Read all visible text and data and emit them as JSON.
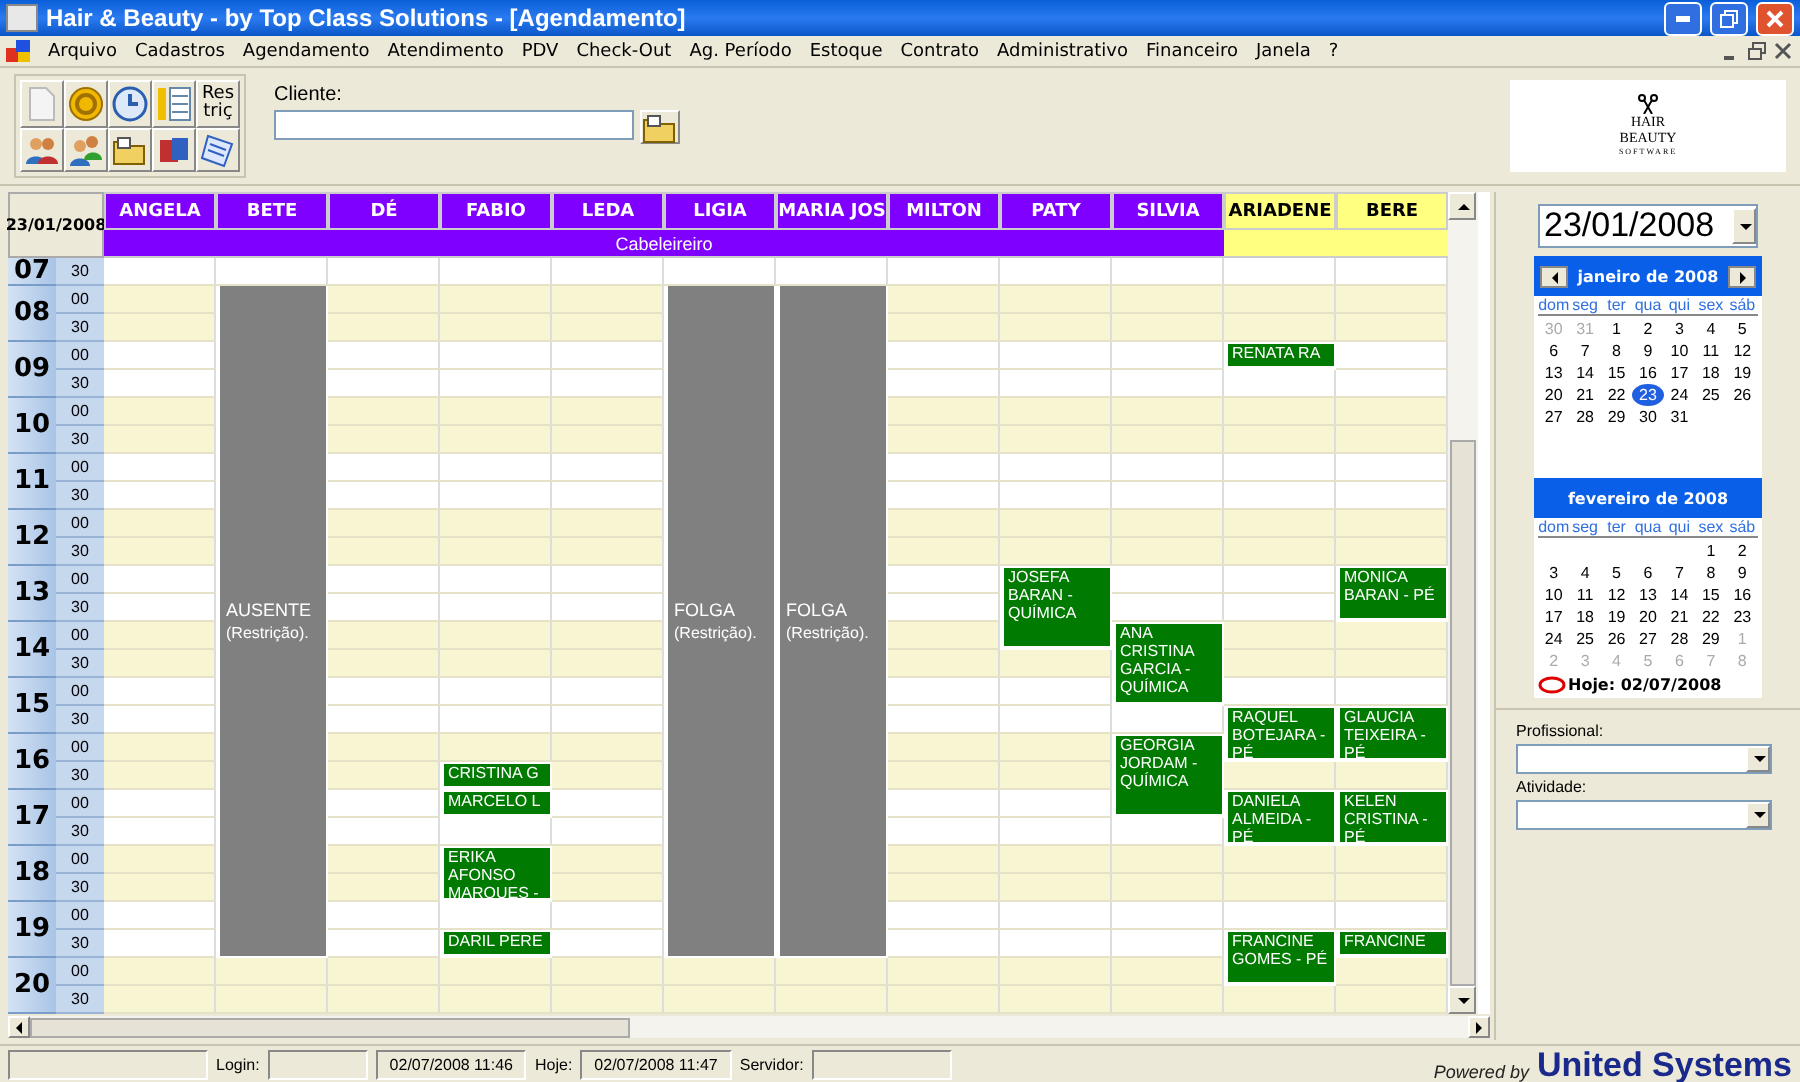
{
  "window": {
    "title": "Hair & Beauty - by Top Class Solutions - [Agendamento]"
  },
  "menu": [
    "Arquivo",
    "Cadastros",
    "Agendamento",
    "Atendimento",
    "PDV",
    "Check-Out",
    "Ag. Período",
    "Estoque",
    "Contrato",
    "Administrativo",
    "Financeiro",
    "Janela",
    "?"
  ],
  "toolbar": [
    {
      "kind": "icon"
    },
    {
      "kind": "icon"
    },
    {
      "kind": "icon"
    },
    {
      "kind": "icon"
    },
    {
      "kind": "text",
      "label": "Res triç"
    },
    {
      "kind": "icon"
    },
    {
      "kind": "icon"
    },
    {
      "kind": "icon"
    },
    {
      "kind": "icon"
    },
    {
      "kind": "icon"
    }
  ],
  "client": {
    "label": "Cliente:"
  },
  "logo": {
    "line_1": "HAIR",
    "line_2": "BEAUTY",
    "line_3": "SOFTWARE"
  },
  "schedule": {
    "date": "23/01/2008",
    "groups": [
      {
        "label": "Cabeleireiro",
        "color": "#8000ff",
        "columns": [
          "ANGELA",
          "BETE",
          "DÉ",
          "FABIO",
          "LEDA",
          "LIGIA",
          "MARIA JOS",
          "MILTON",
          "PATY",
          "SILVIA"
        ]
      },
      {
        "color": "#ffff80",
        "columns": [
          "ARIADENE",
          "BERE"
        ]
      }
    ],
    "hours": [
      {
        "hour": "07",
        "rows": [
          {
            "minute": "30",
            "cells": [
              {
                "kind": "free"
              },
              {
                "kind": "free"
              },
              {
                "kind": "free"
              },
              {
                "kind": "free"
              },
              {
                "kind": "free"
              },
              {
                "kind": "free"
              },
              {
                "kind": "free"
              },
              {
                "kind": "free"
              },
              {
                "kind": "free"
              },
              {
                "kind": "free"
              },
              {
                "kind": "free"
              },
              {
                "kind": "free"
              }
            ]
          }
        ]
      },
      {
        "hour": "08",
        "rows": [
          {
            "minute": "00",
            "cells": [
              {
                "kind": "free"
              },
              {
                "kind": "restriction",
                "text": "AUSENTE",
                "note": "(Restrição)."
              },
              {
                "kind": "free"
              },
              {
                "kind": "free"
              },
              {
                "kind": "free"
              },
              {
                "kind": "restriction",
                "text": "FOLGA",
                "note": "(Restrição)."
              },
              {
                "kind": "restriction",
                "text": "FOLGA",
                "note": "(Restrição)."
              },
              {
                "kind": "free"
              },
              {
                "kind": "free"
              },
              {
                "kind": "free"
              },
              {
                "kind": "free"
              },
              {
                "kind": "free"
              }
            ]
          },
          {
            "minute": "30",
            "cells": [
              {
                "kind": "free"
              },
              {
                "kind": "cont"
              },
              {
                "kind": "free"
              },
              {
                "kind": "free"
              },
              {
                "kind": "free"
              },
              {
                "kind": "cont"
              },
              {
                "kind": "cont"
              },
              {
                "kind": "free"
              },
              {
                "kind": "free"
              },
              {
                "kind": "free"
              },
              {
                "kind": "free"
              },
              {
                "kind": "free"
              }
            ]
          }
        ]
      },
      {
        "hour": "09",
        "rows": [
          {
            "minute": "00",
            "cells": [
              {
                "kind": "free"
              },
              {
                "kind": "cont"
              },
              {
                "kind": "free"
              },
              {
                "kind": "free"
              },
              {
                "kind": "free"
              },
              {
                "kind": "cont"
              },
              {
                "kind": "cont"
              },
              {
                "kind": "free"
              },
              {
                "kind": "free"
              },
              {
                "kind": "free"
              },
              {
                "kind": "booking",
                "text": "RENATA RA"
              },
              {
                "kind": "free"
              }
            ]
          },
          {
            "minute": "30",
            "cells": [
              {
                "kind": "free"
              },
              {
                "kind": "cont"
              },
              {
                "kind": "free"
              },
              {
                "kind": "free"
              },
              {
                "kind": "free"
              },
              {
                "kind": "cont"
              },
              {
                "kind": "cont"
              },
              {
                "kind": "free"
              },
              {
                "kind": "free"
              },
              {
                "kind": "free"
              },
              {
                "kind": "free"
              },
              {
                "kind": "free"
              }
            ]
          }
        ]
      },
      {
        "hour": "10",
        "rows": [
          {
            "minute": "00",
            "cells": [
              {
                "kind": "free"
              },
              {
                "kind": "cont"
              },
              {
                "kind": "free"
              },
              {
                "kind": "free"
              },
              {
                "kind": "free"
              },
              {
                "kind": "cont"
              },
              {
                "kind": "cont"
              },
              {
                "kind": "free"
              },
              {
                "kind": "free"
              },
              {
                "kind": "free"
              },
              {
                "kind": "free"
              },
              {
                "kind": "free"
              }
            ]
          },
          {
            "minute": "30",
            "cells": [
              {
                "kind": "free"
              },
              {
                "kind": "cont"
              },
              {
                "kind": "free"
              },
              {
                "kind": "free"
              },
              {
                "kind": "free"
              },
              {
                "kind": "cont"
              },
              {
                "kind": "cont"
              },
              {
                "kind": "free"
              },
              {
                "kind": "free"
              },
              {
                "kind": "free"
              },
              {
                "kind": "free"
              },
              {
                "kind": "free"
              }
            ]
          }
        ]
      },
      {
        "hour": "11",
        "rows": [
          {
            "minute": "00",
            "cells": [
              {
                "kind": "free"
              },
              {
                "kind": "cont"
              },
              {
                "kind": "free"
              },
              {
                "kind": "free"
              },
              {
                "kind": "free"
              },
              {
                "kind": "cont"
              },
              {
                "kind": "cont"
              },
              {
                "kind": "free"
              },
              {
                "kind": "free"
              },
              {
                "kind": "free"
              },
              {
                "kind": "free"
              },
              {
                "kind": "free"
              }
            ]
          },
          {
            "minute": "30",
            "cells": [
              {
                "kind": "free"
              },
              {
                "kind": "cont"
              },
              {
                "kind": "free"
              },
              {
                "kind": "free"
              },
              {
                "kind": "free"
              },
              {
                "kind": "cont"
              },
              {
                "kind": "cont"
              },
              {
                "kind": "free"
              },
              {
                "kind": "free"
              },
              {
                "kind": "free"
              },
              {
                "kind": "free"
              },
              {
                "kind": "free"
              }
            ]
          }
        ]
      },
      {
        "hour": "12",
        "rows": [
          {
            "minute": "00",
            "cells": [
              {
                "kind": "free"
              },
              {
                "kind": "cont"
              },
              {
                "kind": "free"
              },
              {
                "kind": "free"
              },
              {
                "kind": "free"
              },
              {
                "kind": "cont"
              },
              {
                "kind": "cont"
              },
              {
                "kind": "free"
              },
              {
                "kind": "free"
              },
              {
                "kind": "free"
              },
              {
                "kind": "free"
              },
              {
                "kind": "free"
              }
            ]
          },
          {
            "minute": "30",
            "cells": [
              {
                "kind": "free"
              },
              {
                "kind": "cont"
              },
              {
                "kind": "free"
              },
              {
                "kind": "free"
              },
              {
                "kind": "free"
              },
              {
                "kind": "cont"
              },
              {
                "kind": "cont"
              },
              {
                "kind": "free"
              },
              {
                "kind": "free"
              },
              {
                "kind": "free"
              },
              {
                "kind": "free"
              },
              {
                "kind": "free"
              }
            ]
          }
        ]
      },
      {
        "hour": "13",
        "rows": [
          {
            "minute": "00",
            "cells": [
              {
                "kind": "free"
              },
              {
                "kind": "cont"
              },
              {
                "kind": "free"
              },
              {
                "kind": "free"
              },
              {
                "kind": "free"
              },
              {
                "kind": "cont"
              },
              {
                "kind": "cont"
              },
              {
                "kind": "free"
              },
              {
                "kind": "booking",
                "text": "JOSEFA BARAN - QUÍMICA"
              },
              {
                "kind": "free"
              },
              {
                "kind": "free"
              },
              {
                "kind": "booking",
                "text": "MONICA BARAN - PÉ"
              }
            ]
          },
          {
            "minute": "30",
            "cells": [
              {
                "kind": "free"
              },
              {
                "kind": "cont"
              },
              {
                "kind": "free"
              },
              {
                "kind": "free"
              },
              {
                "kind": "free"
              },
              {
                "kind": "cont"
              },
              {
                "kind": "cont"
              },
              {
                "kind": "free"
              },
              {
                "kind": "cont"
              },
              {
                "kind": "free"
              },
              {
                "kind": "free"
              },
              {
                "kind": "cont"
              }
            ]
          }
        ]
      },
      {
        "hour": "14",
        "rows": [
          {
            "minute": "00",
            "cells": [
              {
                "kind": "free"
              },
              {
                "kind": "cont"
              },
              {
                "kind": "free"
              },
              {
                "kind": "free"
              },
              {
                "kind": "free"
              },
              {
                "kind": "cont"
              },
              {
                "kind": "cont"
              },
              {
                "kind": "free"
              },
              {
                "kind": "cont"
              },
              {
                "kind": "booking",
                "text": "ANA CRISTINA GARCIA - QUÍMICA"
              },
              {
                "kind": "free"
              },
              {
                "kind": "free"
              }
            ]
          },
          {
            "minute": "30",
            "cells": [
              {
                "kind": "free"
              },
              {
                "kind": "cont"
              },
              {
                "kind": "free"
              },
              {
                "kind": "free"
              },
              {
                "kind": "free"
              },
              {
                "kind": "cont"
              },
              {
                "kind": "cont"
              },
              {
                "kind": "free"
              },
              {
                "kind": "free"
              },
              {
                "kind": "cont"
              },
              {
                "kind": "free"
              },
              {
                "kind": "free"
              }
            ]
          }
        ]
      },
      {
        "hour": "15",
        "rows": [
          {
            "minute": "00",
            "cells": [
              {
                "kind": "free"
              },
              {
                "kind": "cont"
              },
              {
                "kind": "free"
              },
              {
                "kind": "free"
              },
              {
                "kind": "free"
              },
              {
                "kind": "cont"
              },
              {
                "kind": "cont"
              },
              {
                "kind": "free"
              },
              {
                "kind": "free"
              },
              {
                "kind": "cont"
              },
              {
                "kind": "free"
              },
              {
                "kind": "free"
              }
            ]
          },
          {
            "minute": "30",
            "cells": [
              {
                "kind": "free"
              },
              {
                "kind": "cont"
              },
              {
                "kind": "free"
              },
              {
                "kind": "free"
              },
              {
                "kind": "free"
              },
              {
                "kind": "cont"
              },
              {
                "kind": "cont"
              },
              {
                "kind": "free"
              },
              {
                "kind": "free"
              },
              {
                "kind": "free"
              },
              {
                "kind": "booking",
                "text": "RAQUEL BOTEJARA - PÉ"
              },
              {
                "kind": "booking",
                "text": "GLAUCIA TEIXEIRA - PÉ"
              }
            ]
          }
        ]
      },
      {
        "hour": "16",
        "rows": [
          {
            "minute": "00",
            "cells": [
              {
                "kind": "free"
              },
              {
                "kind": "cont"
              },
              {
                "kind": "free"
              },
              {
                "kind": "free"
              },
              {
                "kind": "free"
              },
              {
                "kind": "cont"
              },
              {
                "kind": "cont"
              },
              {
                "kind": "free"
              },
              {
                "kind": "free"
              },
              {
                "kind": "booking",
                "text": "GEORGIA JORDAM - QUÍMICA"
              },
              {
                "kind": "cont"
              },
              {
                "kind": "cont"
              }
            ]
          },
          {
            "minute": "30",
            "cells": [
              {
                "kind": "free"
              },
              {
                "kind": "cont"
              },
              {
                "kind": "free"
              },
              {
                "kind": "booking",
                "text": "CRISTINA G"
              },
              {
                "kind": "free"
              },
              {
                "kind": "cont"
              },
              {
                "kind": "cont"
              },
              {
                "kind": "free"
              },
              {
                "kind": "free"
              },
              {
                "kind": "cont"
              },
              {
                "kind": "free"
              },
              {
                "kind": "free"
              }
            ]
          }
        ]
      },
      {
        "hour": "17",
        "rows": [
          {
            "minute": "00",
            "cells": [
              {
                "kind": "free"
              },
              {
                "kind": "cont"
              },
              {
                "kind": "free"
              },
              {
                "kind": "booking",
                "text": "MARCELO L"
              },
              {
                "kind": "free"
              },
              {
                "kind": "cont"
              },
              {
                "kind": "cont"
              },
              {
                "kind": "free"
              },
              {
                "kind": "free"
              },
              {
                "kind": "cont"
              },
              {
                "kind": "booking",
                "text": "DANIELA ALMEIDA - PÉ"
              },
              {
                "kind": "booking",
                "text": "KELEN CRISTINA - PÉ"
              }
            ]
          },
          {
            "minute": "30",
            "cells": [
              {
                "kind": "free"
              },
              {
                "kind": "cont"
              },
              {
                "kind": "free"
              },
              {
                "kind": "free"
              },
              {
                "kind": "free"
              },
              {
                "kind": "cont"
              },
              {
                "kind": "cont"
              },
              {
                "kind": "free"
              },
              {
                "kind": "free"
              },
              {
                "kind": "free"
              },
              {
                "kind": "cont"
              },
              {
                "kind": "cont"
              }
            ]
          }
        ]
      },
      {
        "hour": "18",
        "rows": [
          {
            "minute": "00",
            "cells": [
              {
                "kind": "free"
              },
              {
                "kind": "cont"
              },
              {
                "kind": "free"
              },
              {
                "kind": "booking",
                "text": "ERIKA AFONSO MARQUES -"
              },
              {
                "kind": "free"
              },
              {
                "kind": "cont"
              },
              {
                "kind": "cont"
              },
              {
                "kind": "free"
              },
              {
                "kind": "free"
              },
              {
                "kind": "free"
              },
              {
                "kind": "free"
              },
              {
                "kind": "free"
              }
            ]
          },
          {
            "minute": "30",
            "cells": [
              {
                "kind": "free"
              },
              {
                "kind": "cont"
              },
              {
                "kind": "free"
              },
              {
                "kind": "cont"
              },
              {
                "kind": "free"
              },
              {
                "kind": "cont"
              },
              {
                "kind": "cont"
              },
              {
                "kind": "free"
              },
              {
                "kind": "free"
              },
              {
                "kind": "free"
              },
              {
                "kind": "free"
              },
              {
                "kind": "free"
              }
            ]
          }
        ]
      },
      {
        "hour": "19",
        "rows": [
          {
            "minute": "00",
            "cells": [
              {
                "kind": "free"
              },
              {
                "kind": "cont"
              },
              {
                "kind": "free"
              },
              {
                "kind": "free"
              },
              {
                "kind": "free"
              },
              {
                "kind": "cont"
              },
              {
                "kind": "cont"
              },
              {
                "kind": "free"
              },
              {
                "kind": "free"
              },
              {
                "kind": "free"
              },
              {
                "kind": "free"
              },
              {
                "kind": "free"
              }
            ]
          },
          {
            "minute": "30",
            "cells": [
              {
                "kind": "free"
              },
              {
                "kind": "cont"
              },
              {
                "kind": "free"
              },
              {
                "kind": "booking",
                "text": "DARIL PERE"
              },
              {
                "kind": "free"
              },
              {
                "kind": "cont"
              },
              {
                "kind": "cont"
              },
              {
                "kind": "free"
              },
              {
                "kind": "free"
              },
              {
                "kind": "free"
              },
              {
                "kind": "booking",
                "text": "FRANCINE GOMES - PÉ"
              },
              {
                "kind": "booking",
                "text": "FRANCINE"
              }
            ]
          }
        ]
      },
      {
        "hour": "20",
        "rows": [
          {
            "minute": "00",
            "cells": [
              {
                "kind": "free"
              },
              {
                "kind": "free"
              },
              {
                "kind": "free"
              },
              {
                "kind": "free"
              },
              {
                "kind": "free"
              },
              {
                "kind": "free"
              },
              {
                "kind": "free"
              },
              {
                "kind": "free"
              },
              {
                "kind": "free"
              },
              {
                "kind": "free"
              },
              {
                "kind": "cont"
              },
              {
                "kind": "free"
              }
            ]
          },
          {
            "minute": "30",
            "cells": [
              {
                "kind": "free"
              },
              {
                "kind": "free"
              },
              {
                "kind": "free"
              },
              {
                "kind": "free"
              },
              {
                "kind": "free"
              },
              {
                "kind": "free"
              },
              {
                "kind": "free"
              },
              {
                "kind": "free"
              },
              {
                "kind": "free"
              },
              {
                "kind": "free"
              },
              {
                "kind": "free"
              },
              {
                "kind": "free"
              }
            ]
          }
        ]
      }
    ]
  },
  "date_picker": {
    "value": "23/01/2008"
  },
  "calendar": {
    "months": [
      {
        "title": "janeiro de 2008",
        "navigation": true,
        "weekdays": [
          "dom",
          "seg",
          "ter",
          "qua",
          "qui",
          "sex",
          "sáb"
        ],
        "weeks": [
          [
            {
              "day": "30",
              "outside": true,
              "selected": false
            },
            {
              "day": "31",
              "outside": true,
              "selected": false
            },
            {
              "day": "1",
              "outside": false,
              "selected": false
            },
            {
              "day": "2",
              "outside": false,
              "selected": false
            },
            {
              "day": "3",
              "outside": false,
              "selected": false
            },
            {
              "day": "4",
              "outside": false,
              "selected": false
            },
            {
              "day": "5",
              "outside": false,
              "selected": false
            }
          ],
          [
            {
              "day": "6",
              "outside": false,
              "selected": false
            },
            {
              "day": "7",
              "outside": false,
              "selected": false
            },
            {
              "day": "8",
              "outside": false,
              "selected": false
            },
            {
              "day": "9",
              "outside": false,
              "selected": false
            },
            {
              "day": "10",
              "outside": false,
              "selected": false
            },
            {
              "day": "11",
              "outside": false,
              "selected": false
            },
            {
              "day": "12",
              "outside": false,
              "selected": false
            }
          ],
          [
            {
              "day": "13",
              "outside": false,
              "selected": false
            },
            {
              "day": "14",
              "outside": false,
              "selected": false
            },
            {
              "day": "15",
              "outside": false,
              "selected": false
            },
            {
              "day": "16",
              "outside": false,
              "selected": false
            },
            {
              "day": "17",
              "outside": false,
              "selected": false
            },
            {
              "day": "18",
              "outside": false,
              "selected": false
            },
            {
              "day": "19",
              "outside": false,
              "selected": false
            }
          ],
          [
            {
              "day": "20",
              "outside": false,
              "selected": false
            },
            {
              "day": "21",
              "outside": false,
              "selected": false
            },
            {
              "day": "22",
              "outside": false,
              "selected": false
            },
            {
              "day": "23",
              "outside": false,
              "selected": true
            },
            {
              "day": "24",
              "outside": false,
              "selected": false
            },
            {
              "day": "25",
              "outside": false,
              "selected": false
            },
            {
              "day": "26",
              "outside": false,
              "selected": false
            }
          ],
          [
            {
              "day": "27",
              "outside": false,
              "selected": false
            },
            {
              "day": "28",
              "outside": false,
              "selected": false
            },
            {
              "day": "29",
              "outside": false,
              "selected": false
            },
            {
              "day": "30",
              "outside": false,
              "selected": false
            },
            {
              "day": "31",
              "outside": false,
              "selected": false
            }
          ]
        ]
      },
      {
        "title": "fevereiro de 2008",
        "navigation": false,
        "weekdays": [
          "dom",
          "seg",
          "ter",
          "qua",
          "qui",
          "sex",
          "sáb"
        ],
        "weeks": [
          [
            {
              "day": "1",
              "outside": false,
              "selected": false
            },
            {
              "day": "2",
              "outside": false,
              "selected": false
            }
          ],
          [
            {
              "day": "3",
              "outside": false,
              "selected": false
            },
            {
              "day": "4",
              "outside": false,
              "selected": false
            },
            {
              "day": "5",
              "outside": false,
              "selected": false
            },
            {
              "day": "6",
              "outside": false,
              "selected": false
            },
            {
              "day": "7",
              "outside": false,
              "selected": false
            },
            {
              "day": "8",
              "outside": false,
              "selected": false
            },
            {
              "day": "9",
              "outside": false,
              "selected": false
            }
          ],
          [
            {
              "day": "10",
              "outside": false,
              "selected": false
            },
            {
              "day": "11",
              "outside": false,
              "selected": false
            },
            {
              "day": "12",
              "outside": false,
              "selected": false
            },
            {
              "day": "13",
              "outside": false,
              "selected": false
            },
            {
              "day": "14",
              "outside": false,
              "selected": false
            },
            {
              "day": "15",
              "outside": false,
              "selected": false
            },
            {
              "day": "16",
              "outside": false,
              "selected": false
            }
          ],
          [
            {
              "day": "17",
              "outside": false,
              "selected": false
            },
            {
              "day": "18",
              "outside": false,
              "selected": false
            },
            {
              "day": "19",
              "outside": false,
              "selected": false
            },
            {
              "day": "20",
              "outside": false,
              "selected": false
            },
            {
              "day": "21",
              "outside": false,
              "selected": false
            },
            {
              "day": "22",
              "outside": false,
              "selected": false
            },
            {
              "day": "23",
              "outside": false,
              "selected": false
            }
          ],
          [
            {
              "day": "24",
              "outside": false,
              "selected": false
            },
            {
              "day": "25",
              "outside": false,
              "selected": false
            },
            {
              "day": "26",
              "outside": false,
              "selected": false
            },
            {
              "day": "27",
              "outside": false,
              "selected": false
            },
            {
              "day": "28",
              "outside": false,
              "selected": false
            },
            {
              "day": "29",
              "outside": false,
              "selected": false
            },
            {
              "day": "1",
              "outside": true,
              "selected": false
            }
          ],
          [
            {
              "day": "2",
              "outside": true,
              "selected": false
            },
            {
              "day": "3",
              "outside": true,
              "selected": false
            },
            {
              "day": "4",
              "outside": true,
              "selected": false
            },
            {
              "day": "5",
              "outside": true,
              "selected": false
            },
            {
              "day": "6",
              "outside": true,
              "selected": false
            },
            {
              "day": "7",
              "outside": true,
              "selected": false
            },
            {
              "day": "8",
              "outside": true,
              "selected": false
            }
          ]
        ]
      }
    ],
    "today": "Hoje: 02/07/2008"
  },
  "filters": [
    {
      "label": "Profissional:"
    },
    {
      "label": "Atividade:"
    }
  ],
  "status_bar": {
    "login_label": "Login:",
    "time_1": "02/07/2008 11:46",
    "today_label": "Hoje:",
    "time_2": "02/07/2008 11:47",
    "server_label": "Servidor:",
    "powered_by": "Powered by",
    "brand": "United Systems"
  }
}
